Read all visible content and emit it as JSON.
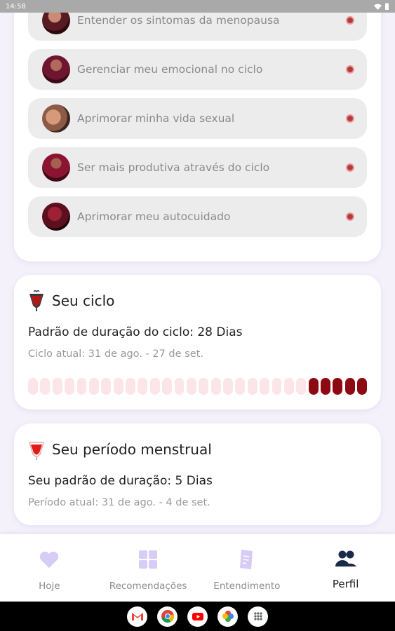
{
  "status_bar": {
    "time": "14:58"
  },
  "goals": [
    {
      "label": "Entender os sintomas da menopausa"
    },
    {
      "label": "Gerenciar meu emocional no ciclo"
    },
    {
      "label": "Aprimorar minha vida sexual"
    },
    {
      "label": "Ser mais produtiva através do ciclo"
    },
    {
      "label": "Aprimorar meu autocuidado"
    }
  ],
  "cycle_card": {
    "title": "Seu ciclo",
    "pattern": "Padrão de duração do ciclo: 28 Dias",
    "current": "Ciclo atual: 31 de ago. - 27 de set.",
    "total_days": 28,
    "period_days": 5
  },
  "period_card": {
    "title": "Seu período menstrual",
    "pattern": "Seu padrão de duração: 5 Dias",
    "current": "Período atual: 31 de ago. - 4 de set."
  },
  "bottom_nav": {
    "items": [
      {
        "label": "Hoje",
        "icon": "heart-icon"
      },
      {
        "label": "Recomendações",
        "icon": "grid-icon"
      },
      {
        "label": "Entendimento",
        "icon": "document-icon"
      },
      {
        "label": "Perfil",
        "icon": "people-icon"
      }
    ],
    "active_index": 3
  },
  "colors": {
    "accent_light": "#d6ccf5",
    "period_red": "#8e0a12",
    "cycle_pink": "#fbe5e8",
    "active_icon": "#1a2a4a"
  },
  "dock": [
    "gmail-icon",
    "chrome-icon",
    "youtube-icon",
    "photos-icon",
    "app-drawer-icon"
  ]
}
